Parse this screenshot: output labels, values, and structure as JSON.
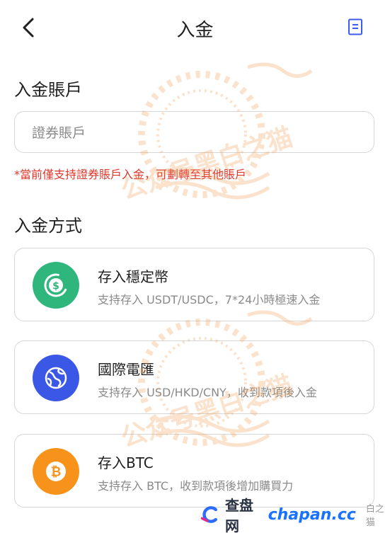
{
  "header": {
    "title": "入金",
    "back_icon": "chevron-left-icon",
    "menu_icon": "document-icon"
  },
  "account_section": {
    "title": "入金賬戶",
    "input_placeholder": "證券賬戶",
    "notice": "*當前僅支持證券賬戶入金，可劃轉至其他賬戶"
  },
  "method_section": {
    "title": "入金方式",
    "methods": [
      {
        "title": "存入穩定幣",
        "desc": "支持存入 USDT/USDC，7*24小時極速入金",
        "icon": "stablecoin-icon",
        "color": "#2fb67c"
      },
      {
        "title": "國際電匯",
        "desc": "支持存入 USD/HKD/CNY，收到款項後入金",
        "icon": "globe-icon",
        "color": "#3b57e6"
      },
      {
        "title": "存入BTC",
        "desc": "支持存入 BTC，收到款項後增加購買力",
        "icon": "bitcoin-icon",
        "color": "#f7931a"
      }
    ]
  },
  "watermark": {
    "text": "公众号黑白之猫",
    "color": "#f39a4a"
  },
  "footer": {
    "brand": "查盘网",
    "url": "chapan.cc",
    "cat_text": "白之猫"
  }
}
